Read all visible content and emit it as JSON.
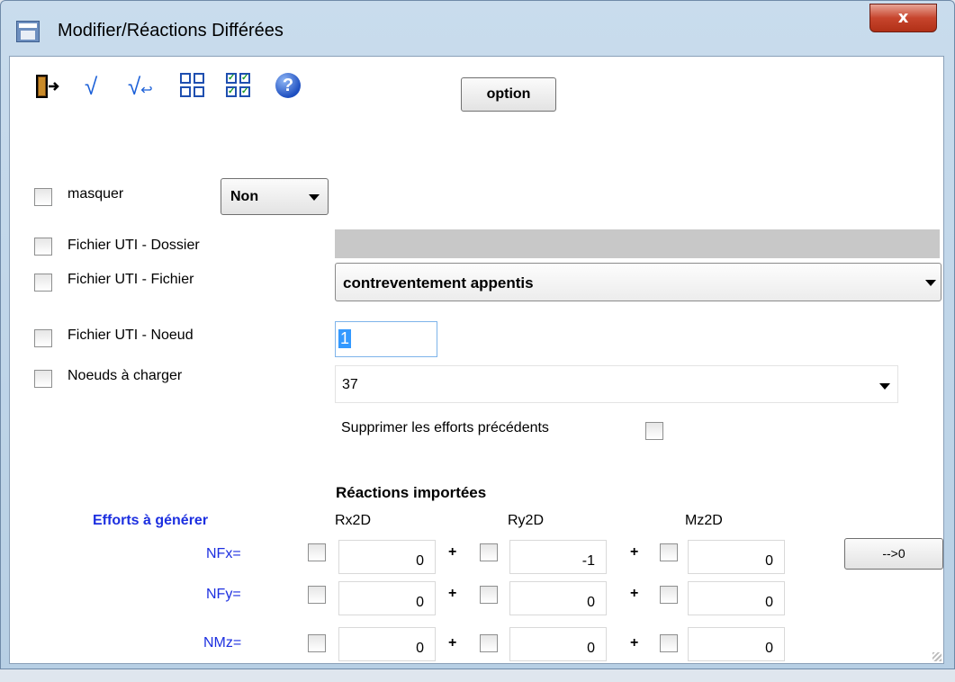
{
  "window": {
    "title": "Modifier/Réactions Différées",
    "close_label": "x"
  },
  "toolbar": {
    "icons": [
      "exit-icon",
      "sqrt-icon",
      "sqrt-return-icon",
      "empty-grid-icon",
      "checked-grid-icon",
      "help-icon"
    ],
    "sqrt_glyph": "√",
    "sqrt_return_glyph": "√",
    "help_glyph": "?",
    "option_label": "option"
  },
  "masquer": {
    "label": "masquer",
    "value": "Non"
  },
  "dossier": {
    "label": "Fichier UTI - Dossier",
    "value": ""
  },
  "fichier": {
    "label": "Fichier UTI - Fichier",
    "value": "contreventement appentis"
  },
  "noeud": {
    "label": "Fichier UTI - Noeud",
    "value": "1"
  },
  "charger": {
    "label": "Noeuds à charger",
    "value": "37"
  },
  "supprimer": {
    "label": "Supprimer les efforts précédents"
  },
  "reactions": {
    "title": "Réactions importées",
    "efforts_label": "Efforts à générer",
    "columns": [
      "Rx2D",
      "Ry2D",
      "Mz2D"
    ],
    "rows": [
      {
        "label": "NFx=",
        "values": [
          "0",
          "-1",
          "0"
        ]
      },
      {
        "label": "NFy=",
        "values": [
          "0",
          "0",
          "0"
        ]
      },
      {
        "label": "NMz=",
        "values": [
          "0",
          "0",
          "0"
        ]
      }
    ],
    "plus": "+",
    "reset_label": "-->0"
  },
  "colors": {
    "accent_blue": "#1c2fe0",
    "title_bg": "#c9dced",
    "close_red": "#c7452d",
    "selection": "#3399ff"
  }
}
